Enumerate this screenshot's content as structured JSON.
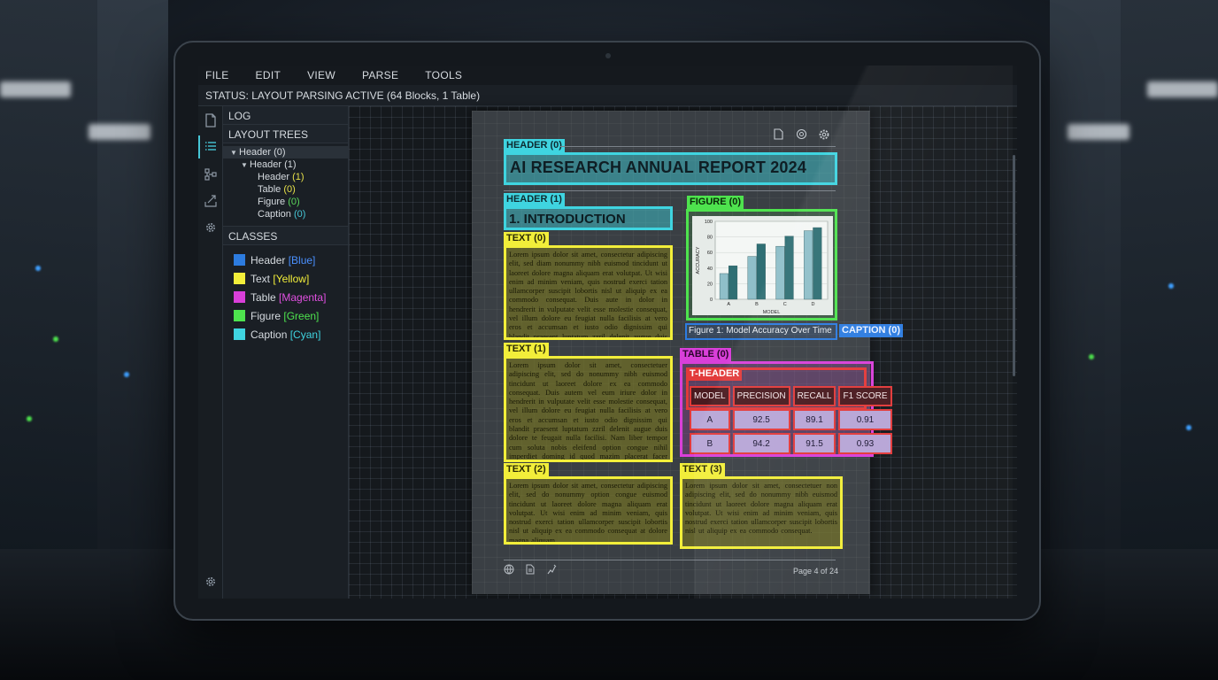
{
  "menu": [
    "FILE",
    "EDIT",
    "VIEW",
    "PARSE",
    "TOOLS"
  ],
  "status": "STATUS: LAYOUT PARSING ACTIVE (64 Blocks, 1 Table)",
  "side": {
    "log_label": "LOG",
    "trees_label": "LAYOUT TREES",
    "tree": [
      {
        "label": "Header",
        "num": "(0)"
      },
      {
        "label": "Header",
        "num": "(1)"
      },
      {
        "label": "Header",
        "num": "(1)"
      },
      {
        "label": "Table",
        "num": "(0)"
      },
      {
        "label": "Figure",
        "num": "(0)"
      },
      {
        "label": "Caption",
        "num": "(0)"
      }
    ],
    "classes_label": "CLASSES",
    "classes": [
      {
        "name": "Header",
        "color_name": "[Blue]",
        "color": "#2d7ce0"
      },
      {
        "name": "Text",
        "color_name": "[Yellow]",
        "color": "#f2ee3a"
      },
      {
        "name": "Table",
        "color_name": "[Magenta]",
        "color": "#d93fd9"
      },
      {
        "name": "Figure",
        "color_name": "[Green]",
        "color": "#4ee34e"
      },
      {
        "name": "Caption",
        "color_name": "[Cyan]",
        "color": "#3fd4e0"
      }
    ]
  },
  "doc": {
    "title_tag": "HEADER (0)",
    "title": "AI RESEARCH ANNUAL REPORT 2024",
    "h1_tag": "HEADER (1)",
    "h1": "1. INTRODUCTION",
    "text0_tag": "TEXT (0)",
    "text0": "Lorem ipsum dolor sit amet, consectetur adipiscing elit, sed diam nonummy nibh euismod tincidunt ut laoreet dolore magna aliquam erat volutpat. Ut wisi enim ad minim veniam, quis nostrud exerci tation ullamcorper suscipit lobortis nisl ut aliquip ex ea commodo consequat. Duis aute in dolor in hendrerit in vulputate velit esse molestie consequat, vel illum dolore eu feugiat nulla facilisis at vero eros et accumsan et iusto odio dignissim qui blandit praesent luptatum zzril delenit augue duis dolore te feugait nulla facilisi.",
    "text1_tag": "TEXT (1)",
    "text1": "Lorem ipsum dolor sit amet, consectetuer adipiscing elit, sed do nonummy nibh euismod tincidunt ut laoreet dolore ex ea commodo consequat. Duis autem vel eum iriure dolor in hendrerit in vulputate velit esse molestie consequat, vel illum dolore eu feugiat nulla facilisis at vero eros et accumsan et iusto odio dignissim qui blandit praesent luptatum zzril delenit augue duis dolore te feugait nulla facilisi. Nam liber tempor cum soluta nobis eleifend option congue nihil imperdiet doming id quod mazim placerat facer possim assum.",
    "text2_tag": "TEXT (2)",
    "text2": "Lorem ipsum dolor sit amet, consectetur adipiscing elit, sed do nonummy option congue euismod tincidunt ut laoreet dolore magna aliquam erat volutpat. Ut wisi enim ad minim veniam, quis nostrud exerci tation ullamcorper suscipit lobortis nisl ut aliquip ex ea commodo consequat at dolore magna aliquam.",
    "text3_tag": "TEXT (3)",
    "text3": "Lorem ipsum dolor sit amet, consectetuer non adipiscing elit, sed do nonummy nibh euismod tincidunt ut laoreet dolore magna aliquam erat volutpat. Ut wisi enim ad minim veniam, quis nostrud exerci tation ullamcorper suscipit lobortis nisl ut aliquip ex ea commodo consequat.",
    "figure_tag": "FIGURE (0)",
    "caption_text": "Figure 1: Model Accuracy Over Time",
    "caption_tag": "CAPTION (0)",
    "table_tag": "TABLE (0)",
    "theader_tag": "T-HEADER",
    "table": {
      "headers": [
        "MODEL",
        "PRECISION",
        "RECALL",
        "F1 SCORE"
      ],
      "rows": [
        [
          "A",
          "92.5",
          "89.1",
          "0.91"
        ],
        [
          "B",
          "94.2",
          "91.5",
          "0.93"
        ]
      ]
    },
    "page_num": "Page 4 of 24"
  },
  "chart_data": {
    "type": "bar",
    "categories": [
      "A",
      "B",
      "C",
      "D"
    ],
    "series": [
      {
        "values": [
          33,
          55,
          68,
          88
        ]
      },
      {
        "values": [
          43,
          71,
          81,
          92
        ]
      }
    ],
    "colors": [
      "#8fbfc9",
      "#2f6f74"
    ],
    "ylim": [
      0,
      100
    ],
    "yticks": [
      0,
      20,
      40,
      60,
      80,
      100
    ],
    "xlabel": "MODEL",
    "ylabel": "ACCURACY"
  }
}
